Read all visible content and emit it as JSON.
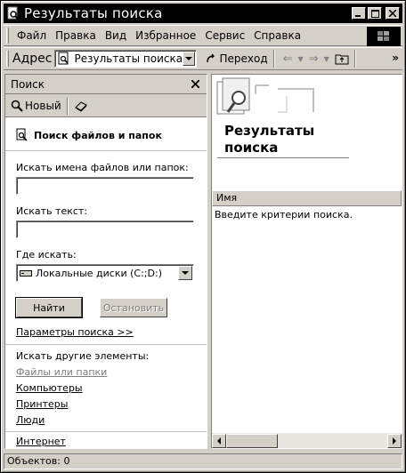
{
  "window": {
    "title": "Результаты поиска"
  },
  "titlebar_buttons": {
    "minimize": "_",
    "maximize": "□",
    "close": "✕"
  },
  "menu": [
    "Файл",
    "Правка",
    "Вид",
    "Избранное",
    "Сервис",
    "Справка"
  ],
  "address": {
    "label": "Адрес",
    "value": "Результаты поиска",
    "go_label": "Переход"
  },
  "search_pane": {
    "header": "Поиск",
    "close_glyph": "✕",
    "new_label": "Новый",
    "section_title": "Поиск файлов и папок",
    "names_label": "Искать имена файлов или папок:",
    "names_value": "",
    "text_label": "Искать текст:",
    "text_value": "",
    "where_label": "Где искать:",
    "where_value": "Локальные диски (C:;D:)",
    "find_button": "Найти",
    "stop_button": "Остановить",
    "options_link": "Параметры поиска >>",
    "other_label": "Искать другие элементы:",
    "other_links": [
      "Файлы или папки",
      "Компьютеры",
      "Принтеры",
      "Люди"
    ],
    "internet_link": "Интернет"
  },
  "results": {
    "title_line1": "Результаты",
    "title_line2": "поиска",
    "column_name": "Имя",
    "message": "Введите критерии поиска."
  },
  "status": {
    "text": "Объектов: 0"
  }
}
